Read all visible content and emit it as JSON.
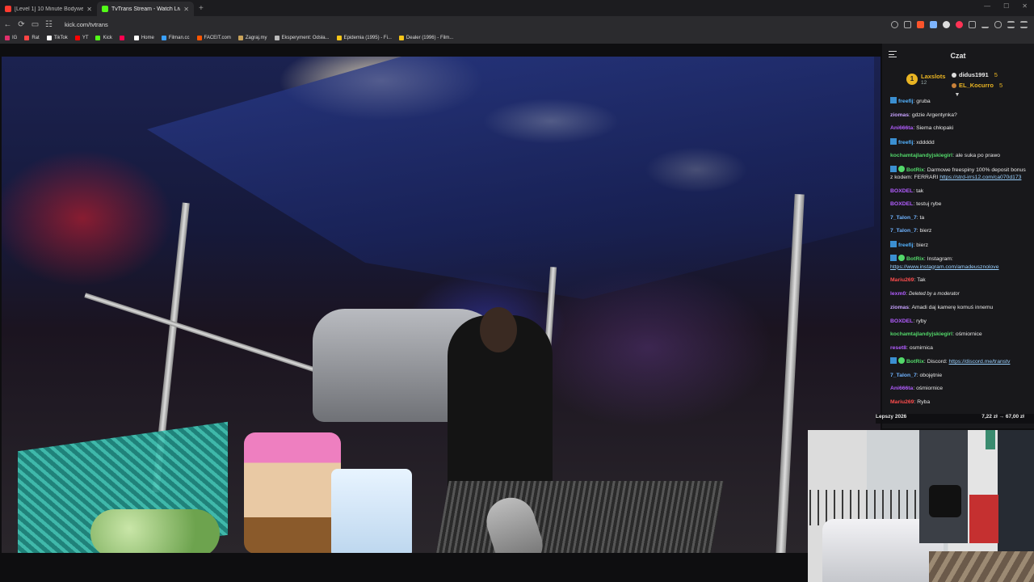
{
  "browser": {
    "tabs": [
      {
        "title": "[Level 1] 10 Minute Bodyweight Wo...",
        "favicon_color": "#ff3b30",
        "active": false
      },
      {
        "title": "TvTrans Stream - Watch Live",
        "favicon_color": "#53fc18",
        "active": true
      }
    ],
    "url": "kick.com/tvtrans",
    "bookmarks": [
      {
        "label": "IG",
        "icon_color": "#e1306c"
      },
      {
        "label": "Rat",
        "icon_color": "#ff4444"
      },
      {
        "label": "TikTok",
        "icon_color": "#ffffff"
      },
      {
        "label": "YT",
        "icon_color": "#ff0000"
      },
      {
        "label": "Kick",
        "icon_color": "#53fc18"
      },
      {
        "label": "",
        "icon_color": "#ff0050"
      },
      {
        "label": "Home",
        "icon_color": "#ffffff"
      },
      {
        "label": "Filman.cc",
        "icon_color": "#39a0ff"
      },
      {
        "label": "FACEIT.com",
        "icon_color": "#ff5500"
      },
      {
        "label": "Zagraj.my",
        "icon_color": "#c9a35a"
      },
      {
        "label": "Eksperyment: Odsła...",
        "icon_color": "#bbbbbb"
      },
      {
        "label": "Epidemia (1995) - Fi...",
        "icon_color": "#f5c518"
      },
      {
        "label": "Dealer (1996) - Film...",
        "icon_color": "#f5c518"
      }
    ]
  },
  "chat": {
    "title": "Czat",
    "leaderboard": {
      "first": {
        "rank": "1",
        "name": "Laxslots",
        "value": "12"
      },
      "second": {
        "name": "didus1991",
        "value": "5"
      },
      "third": {
        "name": "EL_Kocurro",
        "value": "5"
      }
    },
    "messages": [
      {
        "user": "freefij",
        "color": "#53b3ff",
        "badge": "sub",
        "text": "gruba"
      },
      {
        "user": "ziomas",
        "color": "#c8a2ff",
        "badge": "",
        "text": "gdzie Argentynka?"
      },
      {
        "user": "Ani666ta",
        "color": "#b25dff",
        "badge": "",
        "text": "Siema chłopaki"
      },
      {
        "user": "freefij",
        "color": "#53b3ff",
        "badge": "sub",
        "text": "xddddd"
      },
      {
        "user": "kochamtajlandyjskiegirl",
        "color": "#53d86a",
        "badge": "",
        "text": "ale suka po prawo"
      },
      {
        "user": "BotRix",
        "color": "#53d86a",
        "badge": "bot",
        "text": "Darmowe freespiny 100% deposit bonus z kodem: FERRARI ",
        "link": "https://strd-irrs12.com/ca070d173"
      },
      {
        "user": "BOXDEL",
        "color": "#b25dff",
        "badge": "",
        "text": "tak"
      },
      {
        "user": "BOXDEL",
        "color": "#b25dff",
        "badge": "",
        "text": "testuj rybe"
      },
      {
        "user": "7_Talon_7",
        "color": "#6fb3ff",
        "badge": "",
        "text": "ta"
      },
      {
        "user": "7_Talon_7",
        "color": "#6fb3ff",
        "badge": "",
        "text": "bierz"
      },
      {
        "user": "freefij",
        "color": "#53b3ff",
        "badge": "sub",
        "text": "bierz"
      },
      {
        "user": "BotRix",
        "color": "#53d86a",
        "badge": "bot",
        "text": "Instagram: ",
        "link": "https://www.instagram.com/amadeusznolove"
      },
      {
        "user": "Mariu269",
        "color": "#ff4d4d",
        "badge": "",
        "text": "Tak"
      },
      {
        "user": "lexm0",
        "color": "#b25dff",
        "badge": "",
        "text": "Deleted by a moderator",
        "deleted": true
      },
      {
        "user": "ziomas",
        "color": "#c8a2ff",
        "badge": "",
        "text": "Amadi daj kamerę komuś innemu"
      },
      {
        "user": "BOXDEL",
        "color": "#b25dff",
        "badge": "",
        "text": "ryby"
      },
      {
        "user": "kochamtajlandyjskiegirl",
        "color": "#53d86a",
        "badge": "",
        "text": "ośmiornice"
      },
      {
        "user": "reset8",
        "color": "#b25dff",
        "badge": "",
        "text": "osmirnica"
      },
      {
        "user": "BotRix",
        "color": "#53d86a",
        "badge": "bot",
        "text": "Discord: ",
        "link": "https://discord.me/transtv"
      },
      {
        "user": "7_Talon_7",
        "color": "#6fb3ff",
        "badge": "",
        "text": "obojętnie"
      },
      {
        "user": "Ani666ta",
        "color": "#b25dff",
        "badge": "",
        "text": "ośmiornice"
      },
      {
        "user": "Mariu269",
        "color": "#ff4d4d",
        "badge": "",
        "text": "Ryba"
      }
    ]
  },
  "overlay": {
    "left": "Lepszy 2026",
    "right": "7,22 zł → 67,00 zł"
  }
}
